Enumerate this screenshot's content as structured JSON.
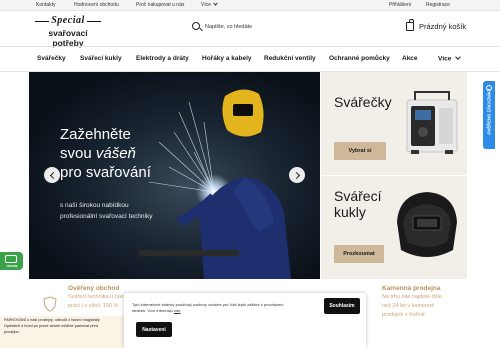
{
  "topbar": {
    "links": [
      "Kontakty",
      "Hodnocení obchodu",
      "Proč nakupovat u nás",
      "Více"
    ],
    "login": "Přihlášení",
    "register": "Registrace"
  },
  "logo": {
    "line1": "Special",
    "line2": "svařovací potřeby"
  },
  "search": {
    "placeholder": "Napište, co hledáte"
  },
  "cart": {
    "label": "Prázdný košík"
  },
  "nav": {
    "items": [
      "Svářečky",
      "Svářecí kukly",
      "Elektrody a dráty",
      "Hořáky a kabely",
      "Redukční ventily",
      "Ochranné pomůcky",
      "Akce",
      "Více"
    ]
  },
  "hero": {
    "title_1": "Zažehněte",
    "title_2a": "svou ",
    "title_2b": "vášeň",
    "title_3": "pro svařování",
    "subtitle_1": "s naší širokou nabídkou",
    "subtitle_2": "profesionální svařovací techniky"
  },
  "promos": [
    {
      "title": "Svářečky",
      "button": "Vybrat si"
    },
    {
      "title_1": "Svářecí",
      "title_2": "kukly",
      "button": "Prozkoumat"
    }
  ],
  "side_tab": {
    "label": "OVĚŘENO ZÁKAZNÍKY"
  },
  "features": [
    {
      "title": "Ověřený obchod",
      "line1": "Svářecí technika u nás",
      "line2": "prácí i s všeli. 100 %"
    },
    {
      "title": "Kamenná prodejna",
      "line1": "Na trhu nás najdete déle",
      "line2": "než 24 let v kamenné",
      "line3": "prodejně v Kolíně"
    }
  ],
  "cookie_left": {
    "line1": "PARKOVÁNÍ u naší prodejny: odbočit z hlavní magistrály",
    "line2": "Opletalch a hned po pravé straně můžete parkovat před",
    "line3": "prodejnu."
  },
  "cookie": {
    "text_1": "Tyto internetové stránky používají soubory cookies pro Váš lepší zážitek z procházení",
    "text_2": "stránek. Více informací ",
    "link": "zde",
    "accept": "Souhlasím",
    "settings": "Nastavení"
  },
  "chat": {
    "label": "ONLINE"
  },
  "colors": {
    "accent": "#cdb89a",
    "gold_text": "#b8935e",
    "hero_bg": "#0d1722",
    "side_tab": "#2b8be6",
    "chat": "#3aa34a"
  }
}
